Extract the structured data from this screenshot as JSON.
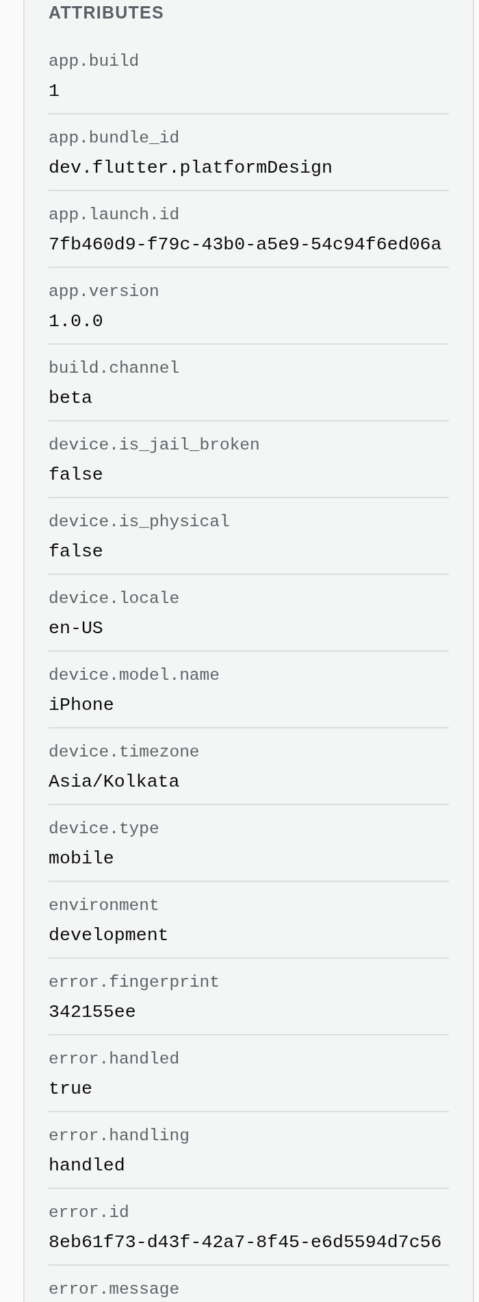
{
  "section": {
    "title": "ATTRIBUTES",
    "attributes": [
      {
        "key": "app.build",
        "value": "1"
      },
      {
        "key": "app.bundle_id",
        "value": "dev.flutter.platformDesign"
      },
      {
        "key": "app.launch.id",
        "value": "7fb460d9-f79c-43b0-a5e9-54c94f6ed06a"
      },
      {
        "key": "app.version",
        "value": "1.0.0"
      },
      {
        "key": "build.channel",
        "value": "beta"
      },
      {
        "key": "device.is_jail_broken",
        "value": "false"
      },
      {
        "key": "device.is_physical",
        "value": "false"
      },
      {
        "key": "device.locale",
        "value": "en-US"
      },
      {
        "key": "device.model.name",
        "value": "iPhone"
      },
      {
        "key": "device.timezone",
        "value": "Asia/Kolkata"
      },
      {
        "key": "device.type",
        "value": "mobile"
      },
      {
        "key": "environment",
        "value": "development"
      },
      {
        "key": "error.fingerprint",
        "value": "342155ee"
      },
      {
        "key": "error.handled",
        "value": "true"
      },
      {
        "key": "error.handling",
        "value": "handled"
      },
      {
        "key": "error.id",
        "value": "8eb61f73-d43f-42a7-8f45-e6d5594d7c56"
      },
      {
        "key": "error.message"
      }
    ]
  }
}
